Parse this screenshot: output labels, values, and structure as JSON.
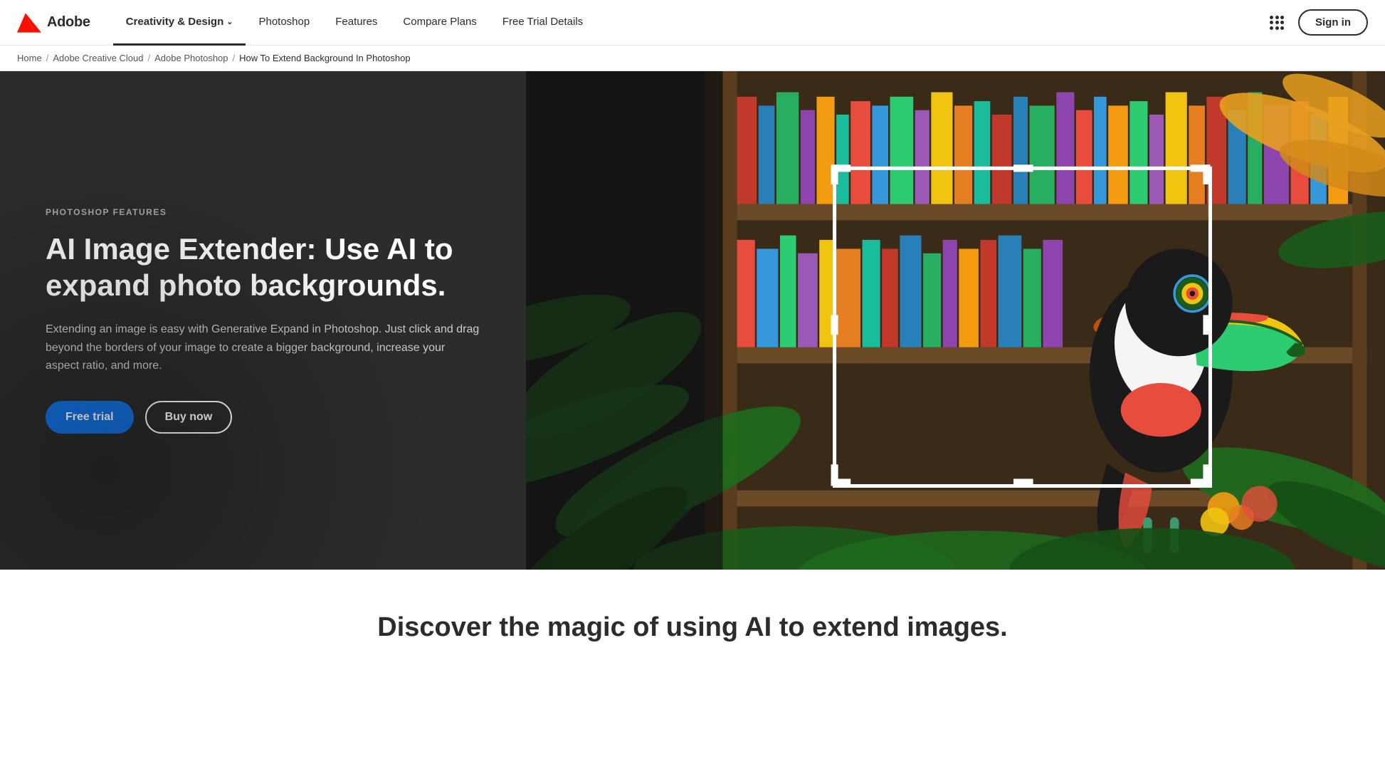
{
  "brand": {
    "logo_alt": "Adobe logo",
    "name": "Adobe"
  },
  "navbar": {
    "links": [
      {
        "id": "creativity-design",
        "label": "Creativity & Design",
        "has_dropdown": true,
        "active": true
      },
      {
        "id": "photoshop",
        "label": "Photoshop",
        "has_dropdown": false,
        "active": false
      },
      {
        "id": "features",
        "label": "Features",
        "has_dropdown": false,
        "active": false
      },
      {
        "id": "compare-plans",
        "label": "Compare Plans",
        "has_dropdown": false,
        "active": false
      },
      {
        "id": "free-trial-details",
        "label": "Free Trial Details",
        "has_dropdown": false,
        "active": false
      }
    ],
    "sign_in_label": "Sign in"
  },
  "breadcrumb": {
    "items": [
      {
        "label": "Home",
        "href": "#"
      },
      {
        "label": "Adobe Creative Cloud",
        "href": "#"
      },
      {
        "label": "Adobe Photoshop",
        "href": "#"
      },
      {
        "label": "How To Extend Background In Photoshop",
        "href": null
      }
    ]
  },
  "hero": {
    "tag": "PHOTOSHOP FEATURES",
    "title": "AI Image Extender: Use AI to expand photo backgrounds.",
    "description": "Extending an image is easy with Generative Expand in Photoshop. Just click and drag beyond the borders of your image to create a bigger background, increase your aspect ratio, and more.",
    "cta_primary": "Free trial",
    "cta_secondary": "Buy now"
  },
  "discover": {
    "title": "Discover the magic of using AI to extend images."
  }
}
